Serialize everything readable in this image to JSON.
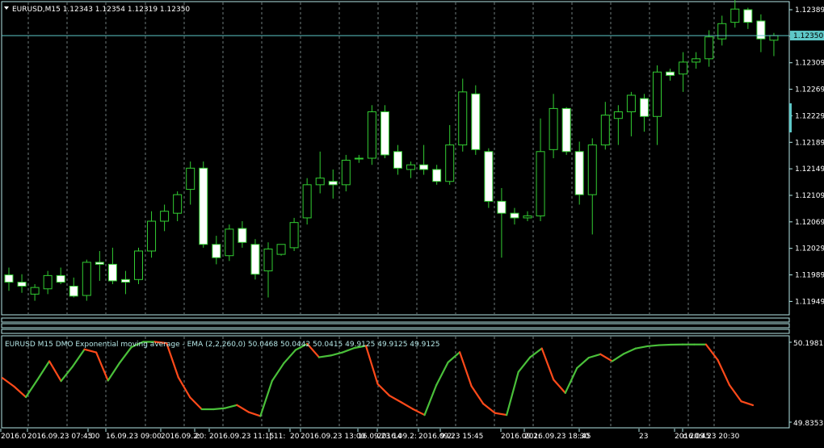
{
  "main_chart": {
    "header": "EURUSD,M15  1.12343 1.12354 1.12319 1.12350",
    "current_price": "1.12350",
    "price_levels": [
      "1.12389",
      "1.12309",
      "1.12269",
      "1.12229",
      "1.12189",
      "1.12149",
      "1.12109",
      "1.12069",
      "1.12029",
      "1.11989",
      "1.11949"
    ]
  },
  "indicator": {
    "header": "EURUSD M15 DMO Exponential moving average - EMA (2,2,260,0) 50.0468 50.0442 50.0415 49.9125 49.9125 49.9125",
    "top_level": "50.1981",
    "bottom_level": "49.8353"
  },
  "time_labels": [
    "2016.0",
    "2016.09.23 07:45",
    ":00",
    "16.09.23 09:00",
    "2016.09.2:",
    "20:",
    "2016.09.23 11:15",
    "| 11:",
    "20",
    "2016.09.23 13:00",
    "16.09.23 14",
    "2016.09.2:",
    "2016.09.23 15:45",
    "9.2:",
    "2016.09.2:",
    "2016.09.23 18:30",
    ":45",
    "23",
    "2016.09.23 20:30",
    "o 20:45"
  ],
  "colors": {
    "background": "#000000",
    "axis": "#b4e6e6",
    "text": "#ffffff",
    "bull_body": "#000000",
    "bear_body": "#ffffff",
    "candle_outline": "#32cd32",
    "price_line": "#5ec8c8",
    "ema_rising": "#4ac03a",
    "ema_falling": "#ff4a1a"
  },
  "chart_data": [
    {
      "type": "candlestick",
      "title": "EURUSD,M15  1.12343 1.12354 1.12319 1.12350",
      "ylim": [
        1.1193,
        1.124
      ],
      "y_ticks": [
        1.12389,
        1.12349,
        1.12309,
        1.12269,
        1.12229,
        1.12189,
        1.12149,
        1.12109,
        1.12069,
        1.12029,
        1.11989,
        1.11949
      ],
      "candles": [
        {
          "o": 1.11989,
          "h": 1.12,
          "l": 1.11965,
          "c": 1.11978
        },
        {
          "o": 1.11978,
          "h": 1.1199,
          "l": 1.11962,
          "c": 1.11972
        },
        {
          "o": 1.1196,
          "h": 1.11975,
          "l": 1.1195,
          "c": 1.1197
        },
        {
          "o": 1.11968,
          "h": 1.11995,
          "l": 1.1196,
          "c": 1.11988
        },
        {
          "o": 1.11988,
          "h": 1.12,
          "l": 1.11975,
          "c": 1.11978
        },
        {
          "o": 1.11972,
          "h": 1.11985,
          "l": 1.11955,
          "c": 1.11957
        },
        {
          "o": 1.11958,
          "h": 1.12012,
          "l": 1.1195,
          "c": 1.12008
        },
        {
          "o": 1.12008,
          "h": 1.12025,
          "l": 1.1198,
          "c": 1.12005
        },
        {
          "o": 1.12005,
          "h": 1.1203,
          "l": 1.11975,
          "c": 1.1198
        },
        {
          "o": 1.11982,
          "h": 1.11995,
          "l": 1.1196,
          "c": 1.11978
        },
        {
          "o": 1.11982,
          "h": 1.1203,
          "l": 1.11975,
          "c": 1.12025
        },
        {
          "o": 1.12025,
          "h": 1.12085,
          "l": 1.12015,
          "c": 1.1207
        },
        {
          "o": 1.1207,
          "h": 1.12095,
          "l": 1.12055,
          "c": 1.12085
        },
        {
          "o": 1.12082,
          "h": 1.12115,
          "l": 1.1207,
          "c": 1.1211
        },
        {
          "o": 1.12118,
          "h": 1.1216,
          "l": 1.12095,
          "c": 1.1215
        },
        {
          "o": 1.1215,
          "h": 1.1216,
          "l": 1.1203,
          "c": 1.12035
        },
        {
          "o": 1.12035,
          "h": 1.12048,
          "l": 1.12005,
          "c": 1.12015
        },
        {
          "o": 1.12018,
          "h": 1.12065,
          "l": 1.1201,
          "c": 1.12058
        },
        {
          "o": 1.12059,
          "h": 1.1207,
          "l": 1.1203,
          "c": 1.12038
        },
        {
          "o": 1.12035,
          "h": 1.12043,
          "l": 1.11982,
          "c": 1.1199
        },
        {
          "o": 1.11995,
          "h": 1.12038,
          "l": 1.11955,
          "c": 1.12028
        },
        {
          "o": 1.1202,
          "h": 1.12035,
          "l": 1.12018,
          "c": 1.12035
        },
        {
          "o": 1.1203,
          "h": 1.12075,
          "l": 1.12025,
          "c": 1.12068
        },
        {
          "o": 1.12075,
          "h": 1.12135,
          "l": 1.12065,
          "c": 1.12125
        },
        {
          "o": 1.12125,
          "h": 1.12175,
          "l": 1.12112,
          "c": 1.12135
        },
        {
          "o": 1.1213,
          "h": 1.12148,
          "l": 1.12104,
          "c": 1.12125
        },
        {
          "o": 1.12125,
          "h": 1.1217,
          "l": 1.12115,
          "c": 1.12162
        },
        {
          "o": 1.12165,
          "h": 1.1217,
          "l": 1.12158,
          "c": 1.12165
        },
        {
          "o": 1.12165,
          "h": 1.12245,
          "l": 1.12155,
          "c": 1.12235
        },
        {
          "o": 1.12235,
          "h": 1.12245,
          "l": 1.12165,
          "c": 1.1217
        },
        {
          "o": 1.12175,
          "h": 1.12185,
          "l": 1.1214,
          "c": 1.1215
        },
        {
          "o": 1.12148,
          "h": 1.1216,
          "l": 1.12135,
          "c": 1.12155
        },
        {
          "o": 1.12155,
          "h": 1.12185,
          "l": 1.1214,
          "c": 1.12148
        },
        {
          "o": 1.12148,
          "h": 1.12155,
          "l": 1.12125,
          "c": 1.1213
        },
        {
          "o": 1.1213,
          "h": 1.12215,
          "l": 1.12125,
          "c": 1.12185
        },
        {
          "o": 1.12185,
          "h": 1.12285,
          "l": 1.12175,
          "c": 1.12265
        },
        {
          "o": 1.12262,
          "h": 1.12275,
          "l": 1.1217,
          "c": 1.12178
        },
        {
          "o": 1.12175,
          "h": 1.1218,
          "l": 1.1209,
          "c": 1.121
        },
        {
          "o": 1.121,
          "h": 1.1212,
          "l": 1.12015,
          "c": 1.12082
        },
        {
          "o": 1.12082,
          "h": 1.1209,
          "l": 1.12065,
          "c": 1.12075
        },
        {
          "o": 1.12075,
          "h": 1.12085,
          "l": 1.1207,
          "c": 1.12078
        },
        {
          "o": 1.12078,
          "h": 1.12225,
          "l": 1.1207,
          "c": 1.12175
        },
        {
          "o": 1.12178,
          "h": 1.12262,
          "l": 1.12165,
          "c": 1.1224
        },
        {
          "o": 1.1224,
          "h": 1.12242,
          "l": 1.1217,
          "c": 1.12175
        },
        {
          "o": 1.12175,
          "h": 1.1219,
          "l": 1.12095,
          "c": 1.1211
        },
        {
          "o": 1.1211,
          "h": 1.12195,
          "l": 1.1205,
          "c": 1.12185
        },
        {
          "o": 1.12185,
          "h": 1.1225,
          "l": 1.12178,
          "c": 1.1223
        },
        {
          "o": 1.12225,
          "h": 1.12245,
          "l": 1.12185,
          "c": 1.12235
        },
        {
          "o": 1.12235,
          "h": 1.12265,
          "l": 1.12198,
          "c": 1.1226
        },
        {
          "o": 1.12255,
          "h": 1.12262,
          "l": 1.12205,
          "c": 1.12228
        },
        {
          "o": 1.12228,
          "h": 1.12305,
          "l": 1.12185,
          "c": 1.12295
        },
        {
          "o": 1.12295,
          "h": 1.123,
          "l": 1.12282,
          "c": 1.1229
        },
        {
          "o": 1.12292,
          "h": 1.12325,
          "l": 1.12265,
          "c": 1.1231
        },
        {
          "o": 1.1231,
          "h": 1.12325,
          "l": 1.123,
          "c": 1.12315
        },
        {
          "o": 1.12315,
          "h": 1.12358,
          "l": 1.12303,
          "c": 1.12348
        },
        {
          "o": 1.12345,
          "h": 1.1238,
          "l": 1.12335,
          "c": 1.12368
        },
        {
          "o": 1.1237,
          "h": 1.12405,
          "l": 1.12362,
          "c": 1.1239
        },
        {
          "o": 1.12389,
          "h": 1.12392,
          "l": 1.1236,
          "c": 1.1237
        },
        {
          "o": 1.12372,
          "h": 1.12382,
          "l": 1.12325,
          "c": 1.12345
        },
        {
          "o": 1.12343,
          "h": 1.12354,
          "l": 1.12319,
          "c": 1.1235
        }
      ]
    },
    {
      "type": "line",
      "title": "EURUSD M15 DMO Exponential moving average - EMA (2,2,260,0) 50.0468 50.0442 50.0415 49.9125 49.9125 49.9125",
      "ylim": [
        49.8353,
        50.1981
      ],
      "values": [
        50.036,
        49.997,
        49.949,
        50.029,
        50.112,
        50.022,
        50.089,
        50.166,
        50.152,
        50.024,
        50.105,
        50.176,
        50.2,
        50.2,
        50.194,
        50.039,
        49.948,
        49.894,
        49.894,
        49.899,
        49.913,
        49.881,
        49.863,
        50.023,
        50.103,
        50.163,
        50.191,
        50.13,
        50.138,
        50.152,
        50.172,
        50.182,
        50.009,
        49.956,
        49.926,
        49.895,
        49.868,
        50.003,
        50.107,
        50.153,
        49.999,
        49.919,
        49.877,
        49.868,
        50.063,
        50.13,
        50.17,
        50.028,
        49.968,
        50.081,
        50.128,
        50.144,
        50.112,
        50.146,
        50.17,
        50.18,
        50.185,
        50.187,
        50.188,
        50.188,
        50.188,
        50.118,
        50.004,
        49.93,
        49.9125
      ],
      "rising_color": "#4ac03a",
      "falling_color": "#ff4a1a"
    }
  ]
}
